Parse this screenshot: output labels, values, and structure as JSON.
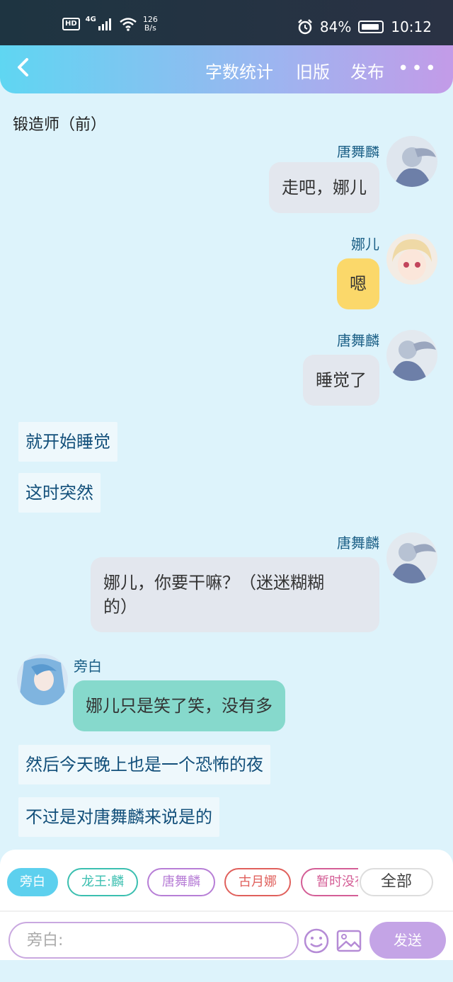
{
  "status_bar": {
    "hd": "HD",
    "network": "4G",
    "speed_value": "126",
    "speed_unit": "B/s",
    "battery": "84%",
    "time": "10:12"
  },
  "header": {
    "word_count": "字数统计",
    "old_version": "旧版",
    "publish": "发布",
    "more": "•••"
  },
  "chapter_title": "锻造师（前）",
  "messages": [
    {
      "type": "right",
      "speaker": "唐舞麟",
      "text": "走吧，娜儿"
    },
    {
      "type": "right",
      "speaker": "娜儿",
      "text": "嗯"
    },
    {
      "type": "right",
      "speaker": "唐舞麟",
      "text": "睡觉了"
    },
    {
      "type": "narration",
      "text": "就开始睡觉"
    },
    {
      "type": "narration",
      "text": "这时突然"
    },
    {
      "type": "right",
      "speaker": "唐舞麟",
      "text_line1": "娜儿，你要干嘛？（迷迷糊糊",
      "text_line2": "的）"
    },
    {
      "type": "left",
      "speaker": "旁白",
      "text": "娜儿只是笑了笑，没有多"
    },
    {
      "type": "narration",
      "text": "然后今天晚上也是一个恐怖的夜"
    },
    {
      "type": "narration",
      "text": "不过是对唐舞麟来说是的"
    }
  ],
  "characters": [
    {
      "label": "旁白",
      "color": "#5dd0ee"
    },
    {
      "label": "龙王:麟",
      "color": "#3bbfb0"
    },
    {
      "label": "唐舞麟",
      "color": "#b77ed6"
    },
    {
      "label": "古月娜",
      "color": "#e0605c"
    },
    {
      "label": "暂时没有",
      "color": "#d45e96"
    }
  ],
  "all_button": "全部",
  "input": {
    "placeholder": "旁白:"
  },
  "send": "发送",
  "colors": {
    "header_start": "#5fd6f2",
    "header_end": "#c39be8",
    "background": "#ddf3fb",
    "send": "#c4a4e6"
  }
}
